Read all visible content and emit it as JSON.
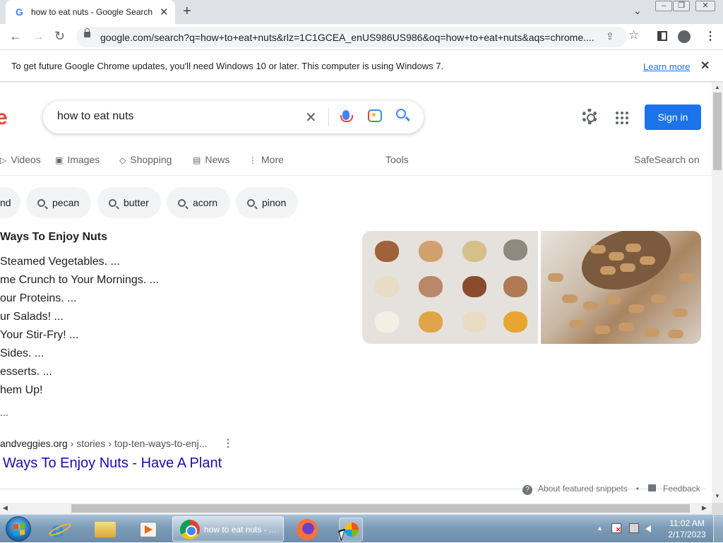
{
  "browser": {
    "tab_title": "how to eat nuts - Google Search",
    "tab_favicon": "G",
    "url": "google.com/search?q=how+to+eat+nuts&rlz=1C1GCEA_enUS986US986&oq=how+to+eat+nuts&aqs=chrome...."
  },
  "infobar": {
    "message": "To get future Google Chrome updates, you'll need Windows 10 or later. This computer is using Windows 7.",
    "learn_more": "Learn more"
  },
  "search": {
    "logo_fragment": "e",
    "query": "how to eat nuts",
    "sign_in": "Sign in",
    "tabs": [
      "Videos",
      "Images",
      "Shopping",
      "News",
      "More"
    ],
    "tools": "Tools",
    "safesearch": "SafeSearch on",
    "chips": [
      "nd",
      "pecan",
      "butter",
      "acorn",
      "pinon"
    ]
  },
  "snippet": {
    "heading": "Ways To Enjoy Nuts",
    "items": [
      "Steamed Vegetables. ...",
      "me Crunch to Your Mornings. ...",
      "our Proteins. ...",
      "ur Salads! ...",
      " Your Stir-Fry! ...",
      "Sides. ...",
      "esserts. ...",
      "hem Up!"
    ],
    "more": "...",
    "cite_domain": "andveggies.org",
    "cite_path": " › stories › top-ten-ways-to-enj...",
    "result_title": " Ways To Enjoy Nuts - Have A Plant",
    "about": "About featured snippets",
    "bullet": "•",
    "feedback": "Feedback"
  },
  "taskbar": {
    "chrome_label": "how to eat nuts - ...",
    "time": "11:02 AM",
    "date": "2/17/2023"
  },
  "colors": {
    "google_blue": "#1a73e8",
    "link_blue": "#1a0dab",
    "taskbar": "#7d9cb8"
  }
}
